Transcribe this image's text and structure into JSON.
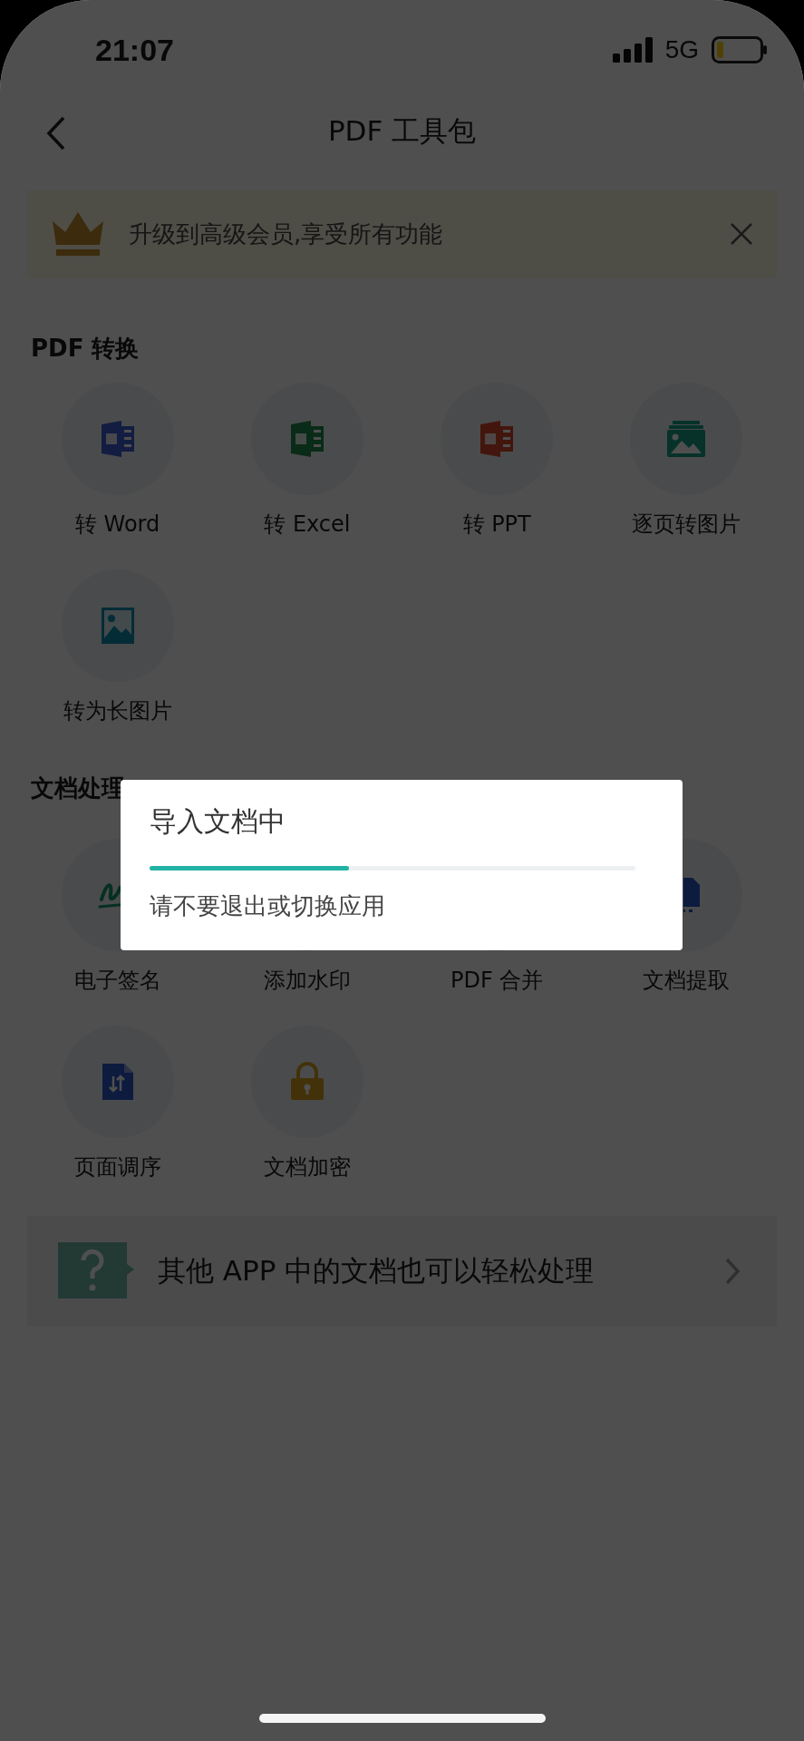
{
  "status_bar": {
    "time": "21:07",
    "network": "5G"
  },
  "nav": {
    "title": "PDF 工具包"
  },
  "promo": {
    "text": "升级到高级会员,享受所有功能"
  },
  "sections": [
    {
      "title": "PDF 转换",
      "tools": [
        {
          "label": "转 Word",
          "kind": "word"
        },
        {
          "label": "转 Excel",
          "kind": "excel"
        },
        {
          "label": "转 PPT",
          "kind": "ppt"
        },
        {
          "label": "逐页转图片",
          "kind": "pages"
        },
        {
          "label": "转为长图片",
          "kind": "longimage"
        }
      ]
    },
    {
      "title": "文档处理",
      "tools": [
        {
          "label": "电子签名",
          "kind": "signature"
        },
        {
          "label": "添加水印"
        },
        {
          "label": "PDF 合并"
        },
        {
          "label": "文档提取",
          "kind": "extract"
        },
        {
          "label": "页面调序",
          "kind": "reorder"
        },
        {
          "label": "文档加密",
          "kind": "lock"
        }
      ]
    }
  ],
  "footer_card": {
    "text": "其他 APP 中的文档也可以轻松处理"
  },
  "dialog": {
    "title": "导入文档中",
    "level": 0.41,
    "message": "请不要退出或切换应用"
  }
}
